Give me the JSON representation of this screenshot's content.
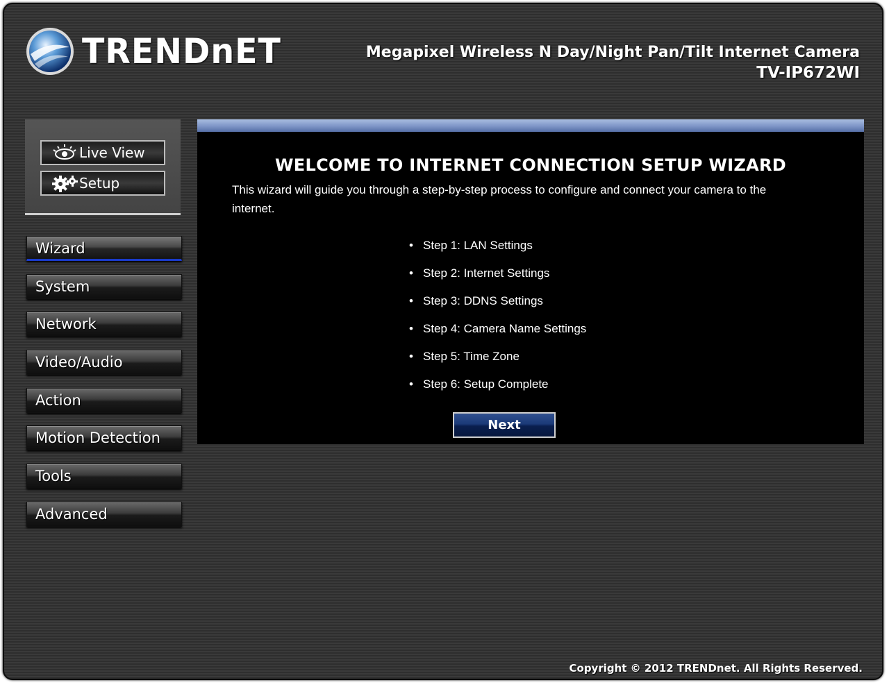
{
  "header": {
    "logo_text": "TRENDnET",
    "product_name": "Megapixel Wireless N Day/Night Pan/Tilt Internet Camera",
    "product_model": "TV-IP672WI"
  },
  "view_buttons": {
    "live_view": {
      "label": "Live View",
      "icon": "eye-icon"
    },
    "setup": {
      "label": "Setup",
      "icon": "gears-icon"
    }
  },
  "menu": {
    "active": "Wizard",
    "items": [
      {
        "label": "Wizard"
      },
      {
        "label": "System"
      },
      {
        "label": "Network"
      },
      {
        "label": "Video/Audio"
      },
      {
        "label": "Action"
      },
      {
        "label": "Motion Detection"
      },
      {
        "label": "Tools"
      },
      {
        "label": "Advanced"
      }
    ]
  },
  "wizard": {
    "title": "WELCOME TO INTERNET CONNECTION SETUP WIZARD",
    "description": "This wizard will guide you through a step-by-step process to configure and connect your camera to the internet.",
    "steps": [
      "Step 1: LAN Settings",
      "Step 2: Internet Settings",
      "Step 3: DDNS Settings",
      "Step 4: Camera Name Settings",
      "Step 5: Time Zone",
      "Step 6: Setup Complete"
    ],
    "next_label": "Next"
  },
  "footer": {
    "copyright": "Copyright © 2012 TRENDnet. All Rights Reserved."
  },
  "colors": {
    "accent_bar": "#7e95c7",
    "active_underline": "#1a3bcc",
    "panel_bg": "#000000",
    "next_button": "#1b3a78"
  }
}
